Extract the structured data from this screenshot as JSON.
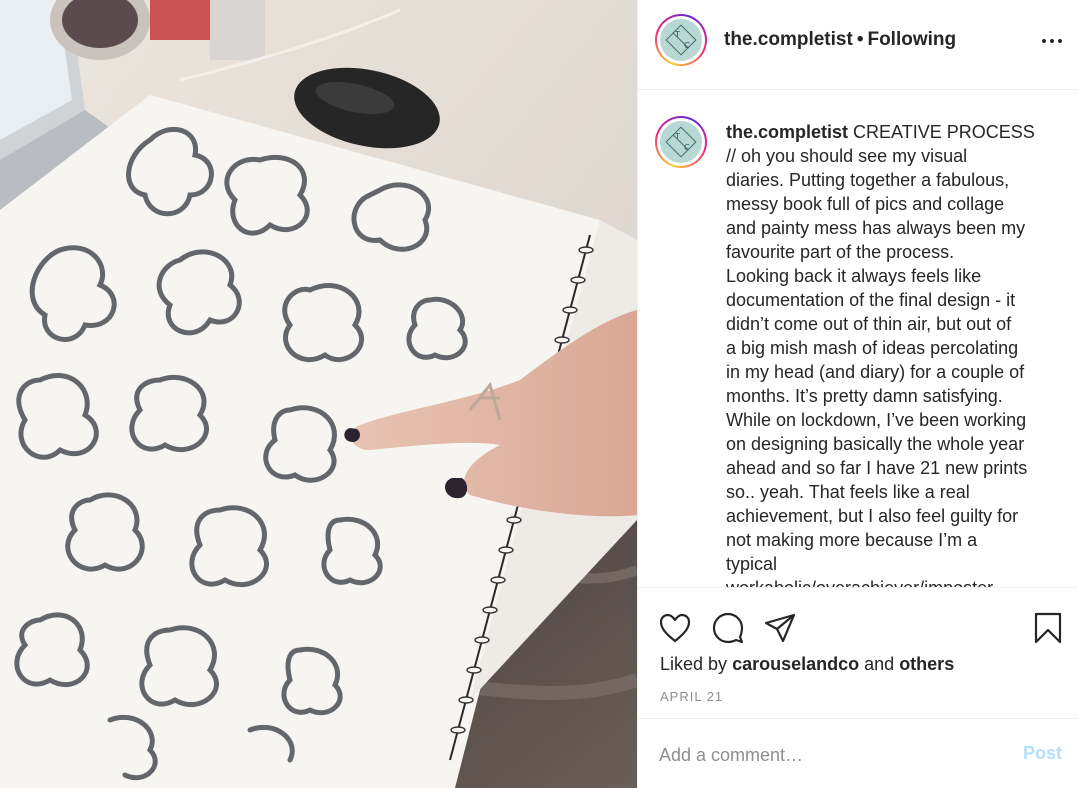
{
  "post": {
    "username": "the.completist",
    "follow_separator": "•",
    "follow_status": "Following",
    "avatar_monogram": [
      "T",
      "C"
    ],
    "caption_lines": [
      "CREATIVE PROCESS",
      "// oh you should see my visual",
      "diaries. Putting together a fabulous,",
      "messy book full of pics and collage",
      "and painty mess has always been my",
      "favourite part of the process.",
      "Looking back it always feels like",
      "documentation of the final design - it",
      "didn’t come out of thin air, but out of",
      "a big mish mash of ideas percolating",
      "in my head (and diary) for a couple of",
      "months. It’s pretty damn satisfying.",
      "While on lockdown, I’ve been working",
      "on designing basically the whole year",
      "ahead and so far I have 21 new prints",
      "so.. yeah. That feels like a real",
      "achievement, but I also feel guilty for",
      "not making more because I’m a",
      "typical",
      "workaholic/overachiever/imposter"
    ],
    "liked_by_prefix": "Liked by",
    "liked_by_user": "carouselandco",
    "liked_by_joiner": "and",
    "liked_by_others": "others",
    "date": "APRIL 21"
  },
  "comment": {
    "placeholder": "Add a comment…",
    "post_label": "Post"
  },
  "icons": {
    "more": "more-options-icon",
    "like": "heart-icon",
    "comment": "comment-bubble-icon",
    "share": "paper-plane-icon",
    "save": "bookmark-icon"
  },
  "colors": {
    "text": "#262626",
    "muted": "#8e8e8e",
    "post_button_disabled": "#b2dffc",
    "divider": "#efefef"
  }
}
